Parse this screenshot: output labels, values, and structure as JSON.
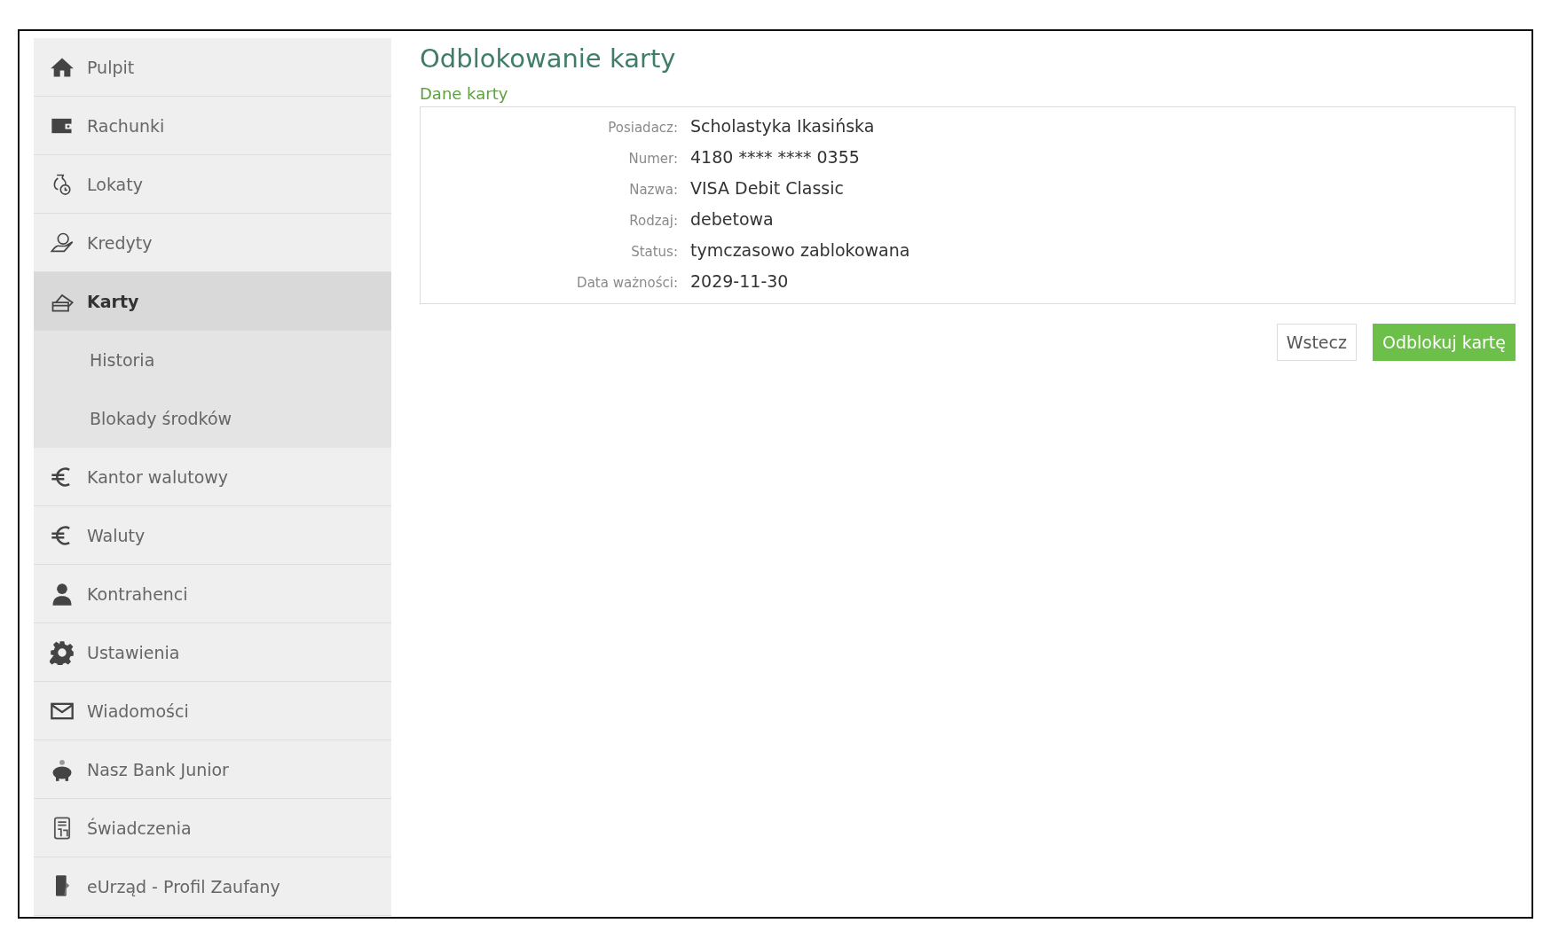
{
  "sidebar": {
    "items": [
      {
        "label": "Pulpit",
        "selected": false
      },
      {
        "label": "Rachunki",
        "selected": false
      },
      {
        "label": "Lokaty",
        "selected": false
      },
      {
        "label": "Kredyty",
        "selected": false
      },
      {
        "label": "Karty",
        "selected": true,
        "expanded": true,
        "children": [
          {
            "label": "Historia",
            "selected": false
          },
          {
            "label": "Blokady środków",
            "selected": false
          }
        ]
      },
      {
        "label": "Kantor walutowy",
        "selected": false
      },
      {
        "label": "Waluty",
        "selected": false
      },
      {
        "label": "Kontrahenci",
        "selected": false
      },
      {
        "label": "Ustawienia",
        "selected": false
      },
      {
        "label": "Wiadomości",
        "selected": false
      },
      {
        "label": "Nasz Bank Junior",
        "selected": false
      },
      {
        "label": "Świadczenia",
        "selected": false
      },
      {
        "label": "eUrząd - Profil Zaufany",
        "selected": false
      }
    ]
  },
  "page": {
    "title": "Odblokowanie karty",
    "section_title": "Dane karty",
    "fields": [
      {
        "label": "Posiadacz:",
        "value": "Scholastyka Ikasińska"
      },
      {
        "label": "Numer:",
        "value": "4180 **** **** 0355"
      },
      {
        "label": "Nazwa:",
        "value": "VISA Debit Classic"
      },
      {
        "label": "Rodzaj:",
        "value": "debetowa"
      },
      {
        "label": "Status:",
        "value": "tymczasowo zablokowana"
      },
      {
        "label": "Data ważności:",
        "value": "2029-11-30"
      }
    ],
    "buttons": [
      {
        "label": "Wstecz",
        "kind": "secondary"
      },
      {
        "label": "Odblokuj kartę",
        "kind": "primary"
      }
    ]
  }
}
